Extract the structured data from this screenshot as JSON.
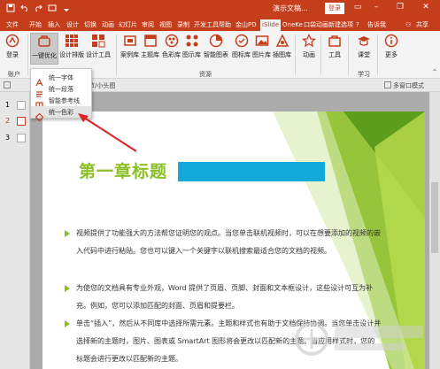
{
  "window": {
    "title": "演示文稿...",
    "login": "登录",
    "tell_me": "告诉我",
    "share": "共享"
  },
  "tabs": [
    "文件",
    "开始",
    "插入",
    "设计",
    "切换",
    "动画",
    "幻灯片",
    "审阅",
    "视图",
    "录制",
    "开发工具",
    "帮助",
    "金山PD",
    "iSlide",
    "OneKe",
    "口袋动画",
    "新建选项"
  ],
  "active_tab": "iSlide",
  "ribbon": {
    "login": "登录",
    "one_click": "一键优化",
    "design_layout": "设计排版",
    "design_tools": "设计工具",
    "case_lib": "案例库",
    "theme_lib": "主题库",
    "color_lib": "色彩库",
    "icon_lib": "图示库",
    "smart_chart": "智能图表",
    "icon_library": "图标库",
    "image_lib": "图片库",
    "illustration_lib": "插图库",
    "animation": "动画",
    "tools": "工具",
    "course": "课堂",
    "more": "更多",
    "group_account": "账户",
    "group_resources": "资源",
    "group_learn": "学习"
  },
  "dropdown": {
    "items": [
      "统一字体",
      "统一段落",
      "智能参考线",
      "统一色彩"
    ],
    "selected": "统一色彩"
  },
  "toolbar2": {
    "section": "节/小头图",
    "label": "多窗口模式"
  },
  "thumbs": [
    "1",
    "2",
    "3"
  ],
  "slide": {
    "title": "第一章标题",
    "paragraphs": [
      "视频提供了功能强大的方法帮您证明您的观点。当您单击联机视频时，可以在想要添加的视频的嵌入代码中进行粘贴。您也可以键入一个关键字以联机搜索最适合您的文档的视频。",
      "为使您的文档具有专业外观，Word 提供了页眉、页脚、封面和文本框设计，这些设计可互为补充。例如，您可以添加匹配的封面、页眉和提要栏。",
      "单击“插入”，然后从不同库中选择所需元素。主题和样式也有助于文档保持协调。当您单击设计并选择新的主题时，图片、图表或 SmartArt 图形将会更改以匹配新的主题。当应用样式时，您的标题会进行更改以匹配新的主题。"
    ]
  },
  "colors": {
    "titlebar": "#c43e1c",
    "accent_green": "#8bbf27",
    "accent_cyan": "#12a8d8"
  }
}
